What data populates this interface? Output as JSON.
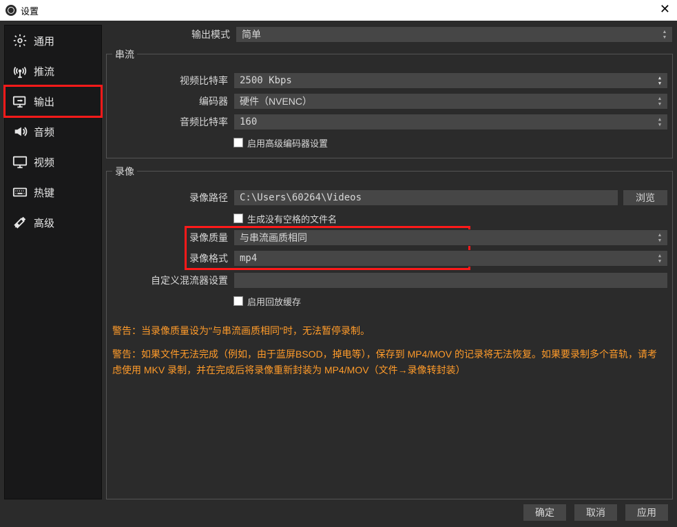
{
  "window": {
    "title": "设置"
  },
  "sidebar": {
    "items": [
      {
        "label": "通用"
      },
      {
        "label": "推流"
      },
      {
        "label": "输出"
      },
      {
        "label": "音频"
      },
      {
        "label": "视频"
      },
      {
        "label": "热键"
      },
      {
        "label": "高级"
      }
    ]
  },
  "outputmode": {
    "label": "输出模式",
    "value": "简单"
  },
  "stream": {
    "title": "串流",
    "video_bitrate_label": "视频比特率",
    "video_bitrate_value": "2500 Kbps",
    "encoder_label": "编码器",
    "encoder_value": "硬件（NVENC）",
    "audio_bitrate_label": "音频比特率",
    "audio_bitrate_value": "160",
    "adv_encoder_label": "启用高级编码器设置"
  },
  "record": {
    "title": "录像",
    "path_label": "录像路径",
    "path_value": "C:\\Users\\60264\\Videos",
    "browse_btn": "浏览",
    "nospace_label": "生成没有空格的文件名",
    "quality_label": "录像质量",
    "quality_value": "与串流画质相同",
    "format_label": "录像格式",
    "format_value": "mp4",
    "mixer_label": "自定义混流器设置",
    "replay_label": "启用回放缓存"
  },
  "warnings": {
    "w1": "警告：当录像质量设为\"与串流画质相同\"时，无法暂停录制。",
    "w2": "警告：如果文件无法完成（例如，由于蓝屏BSOD，掉电等），保存到 MP4/MOV 的记录将无法恢复。如果要录制多个音轨，请考虑使用 MKV 录制，并在完成后将录像重新封装为 MP4/MOV（文件→录像转封装）"
  },
  "footer": {
    "ok": "确定",
    "cancel": "取消",
    "apply": "应用"
  }
}
